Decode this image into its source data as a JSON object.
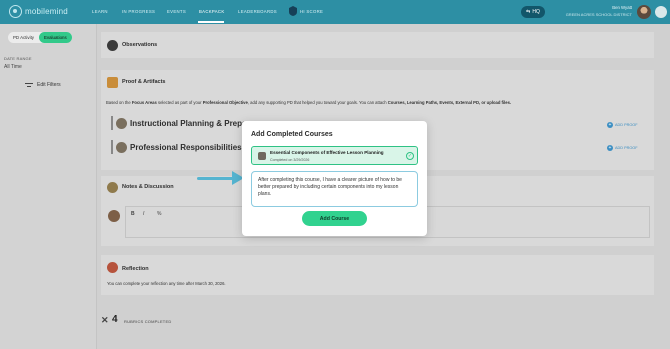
{
  "app": {
    "logo_text": "mobilemind"
  },
  "nav": {
    "items": [
      {
        "label": "LEARN"
      },
      {
        "label": "IN PROGRESS"
      },
      {
        "label": "EVENTS"
      },
      {
        "label": "BACKPACK",
        "active": true
      },
      {
        "label": "LEADERBOARDS"
      },
      {
        "label": "HI SCORE"
      }
    ],
    "hq_label": "HQ",
    "user_name": "Ben Wyatt",
    "user_school": "GREEN ACRES SCHOOL DISTRICT"
  },
  "sidebar": {
    "tabs": [
      {
        "label": "PD Activity"
      },
      {
        "label": "Evaluations",
        "active": true
      }
    ],
    "date_range_label": "DATE RANGE",
    "date_range_value": "All Time",
    "edit_filters": "Edit Filters"
  },
  "main": {
    "observations_title": "Observations",
    "proof_title": "Proof & Artifacts",
    "proof_desc_parts": [
      "Based on the ",
      "Focus Areas",
      " selected as part of your ",
      "Professional Objective",
      ", add any supporting PD that helped you toward your goals. You can attach ",
      "Courses, Learning Paths, Events, External PD, or upload files."
    ],
    "focus_areas": [
      {
        "title": "Instructional Planning & Prepara",
        "add_label": "ADD PROOF"
      },
      {
        "title": "Professional Responsibilities",
        "add_label": "ADD PROOF"
      }
    ],
    "notes_title": "Notes & Discussion",
    "editor_buttons": [
      "B",
      "I",
      "%"
    ],
    "reflection_title": "Reflection",
    "reflection_desc": "You can complete your reflection any time after March 30, 2026.",
    "rubrics_count": "4",
    "rubrics_label": "RUBRICS COMPLETED"
  },
  "modal": {
    "title": "Add Completed Courses",
    "course_title": "Essential Components of Effective Lesson Planning",
    "course_date": "Completed on 3/29/2026",
    "reflection_text": "After completing this course, I have a clearer picture of how to be better prepared by including certain components into my lesson plans.",
    "add_button": "Add Course"
  },
  "colors": {
    "nav_bg": "#2d8fa4",
    "accent_green": "#31d28f",
    "arrow": "#55b4d0",
    "link_blue": "#3b8ec2"
  }
}
